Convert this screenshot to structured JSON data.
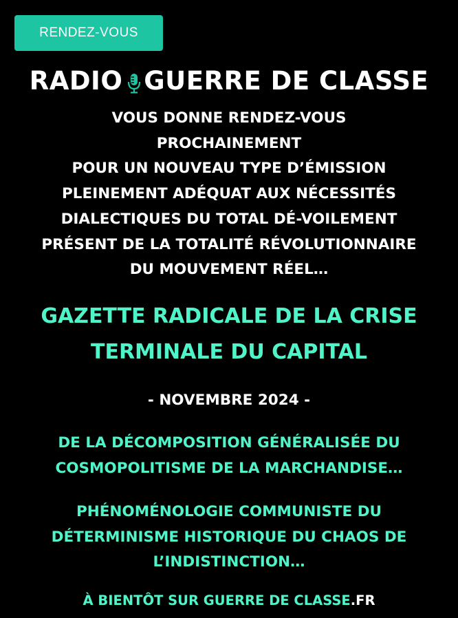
{
  "button": {
    "label": "RENDEZ-VOUS",
    "color": "#1ec5a3"
  },
  "title": {
    "left": "RADIO",
    "icon": "microphone-icon",
    "right": "GUERRE DE CLASSE"
  },
  "intro_lines": [
    "VOUS DONNE RENDEZ-VOUS",
    "PROCHAINEMENT",
    "POUR UN NOUVEAU TYPE D’ÉMISSION",
    "PLEINEMENT ADÉQUAT AUX NÉCESSITÉS",
    "DIALECTIQUES DU TOTAL DÉ-VOILEMENT",
    "PRÉSENT DE LA TOTALITÉ RÉVOLUTIONNAIRE",
    "DU MOUVEMENT RÉEL…"
  ],
  "gazette_lines": [
    "GAZETTE RADICALE DE LA CRISE",
    "TERMINALE DU CAPITAL"
  ],
  "date": "- NOVEMBRE 2024 -",
  "subtitle1_lines": [
    "DE LA DÉCOMPOSITION GÉNÉRALISÉE DU",
    "COSMOPOLITISME DE LA MARCHANDISE…"
  ],
  "subtitle2_lines": [
    "PHÉNOMÉNOLOGIE COMMUNISTE DU",
    "DÉTERMINISME HISTORIQUE DU CHAOS DE",
    "L’INDISTINCTION…"
  ],
  "footer": {
    "text": "À BIENTÔT SUR GUERRE DE CLASSE",
    "tld": ".FR"
  },
  "colors": {
    "background": "#000000",
    "accent": "#4ff5c9",
    "text": "#ffffff"
  }
}
